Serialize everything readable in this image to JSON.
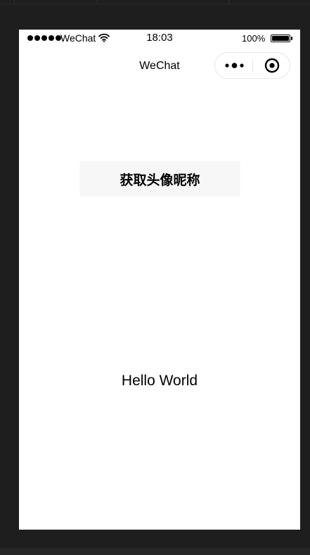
{
  "status_bar": {
    "carrier": "WeChat",
    "time": "18:03",
    "battery_percent": "100%",
    "battery_level": 1.0,
    "signal_icon": "signal-dots-icon",
    "wifi_icon": "wifi-icon",
    "battery_icon": "battery-icon"
  },
  "nav_bar": {
    "title": "WeChat",
    "more_icon": "more-icon",
    "close_icon": "close-miniprogram-icon"
  },
  "main": {
    "get_avatar_button": "获取头像昵称",
    "hello_text": "Hello World"
  }
}
